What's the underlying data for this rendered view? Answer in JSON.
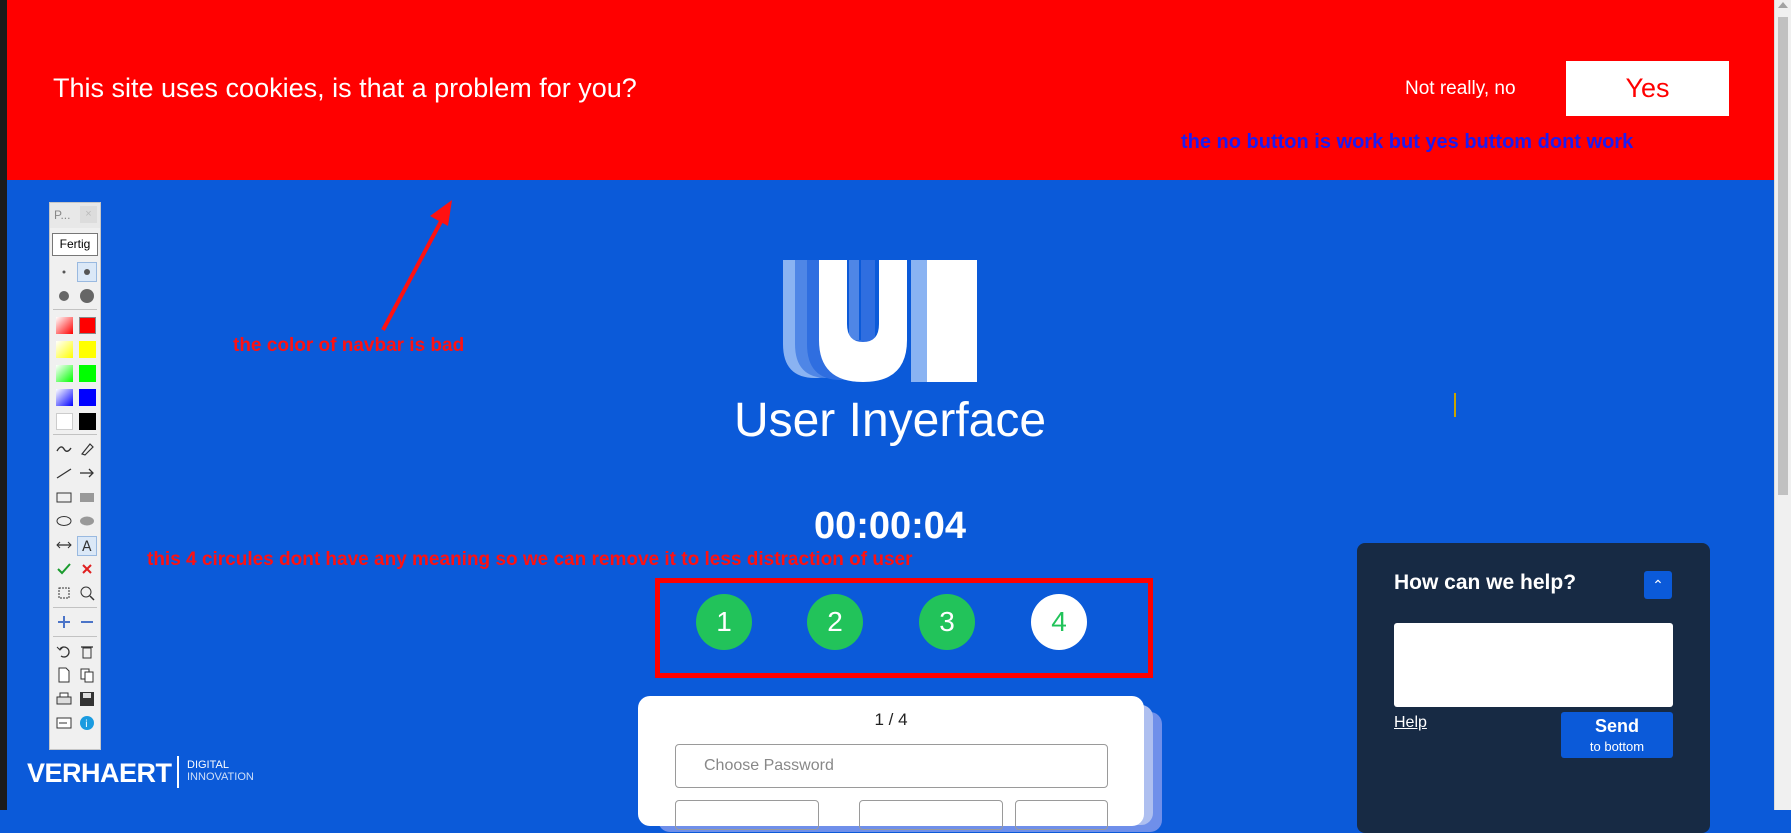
{
  "cookie_banner": {
    "message": "This site uses cookies, is that a problem for you?",
    "decline_label": "Not really, no",
    "accept_label": "Yes"
  },
  "annotations": {
    "buttons_note": "the no button is work but yes buttom dont work",
    "navbar_note": "the color of navbar is bad",
    "circles_note": "this 4 circules dont have any meaning so we can remove it to less distraction of user"
  },
  "brand": {
    "logo_letters": "UI",
    "name": "User Inyerface"
  },
  "timer": "00:00:04",
  "steps": [
    {
      "label": "1",
      "state": "done"
    },
    {
      "label": "2",
      "state": "done"
    },
    {
      "label": "3",
      "state": "done"
    },
    {
      "label": "4",
      "state": "current"
    }
  ],
  "card": {
    "pager": "1 / 4",
    "password_placeholder": "Choose Password"
  },
  "help": {
    "title": "How can we help?",
    "collapse_icon": "chevron-up-icon",
    "link": "Help",
    "send_label": "Send",
    "send_sub": "to bottom"
  },
  "toolbar": {
    "title": "P...",
    "close": "×",
    "done_label": "Fertig",
    "colors": [
      "#ff0000",
      "#ffff00",
      "#00ff00",
      "#0000ff",
      "#ffffff",
      "#000000"
    ]
  },
  "footer_brand": {
    "name": "VERHAERT",
    "sub1": "DIGITAL",
    "sub2": "INNOVATION"
  },
  "colors": {
    "banner": "#ff0000",
    "page": "#0b5ad9",
    "step_done": "#22c35a",
    "help_panel": "#172a44"
  }
}
